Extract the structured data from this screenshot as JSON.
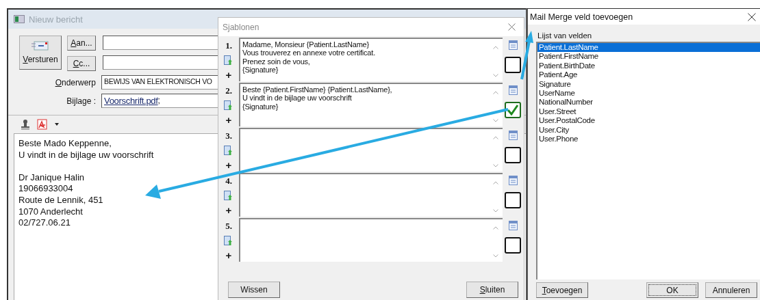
{
  "compose_window": {
    "title": "Nieuw bericht",
    "send_button": "Versturen",
    "to_button": "Aan...",
    "cc_button": "Cc...",
    "subject_label": "Onderwerp",
    "subject_value": "BEWIJS VAN ELEKTRONISCH VO",
    "attachment_label": "Bijlage :",
    "attachment_link": "Voorschrift.pdf",
    "attachment_suffix": ";",
    "body": "Beste Mado Keppenne,\nU vindt in de bijlage uw voorschrift\n\nDr Janique Halin\n19066933004\nRoute de Lennik, 451\n1070 Anderlecht\n02/727.06.21"
  },
  "templates_window": {
    "title": "Sjablonen",
    "templates": [
      {
        "number": "1.",
        "add": "+",
        "text": "Madame, Monsieur {Patient.LastName}\nVous trouverez en annexe votre certificat.\nPrenez soin de vous,\n{Signature}",
        "checked": false
      },
      {
        "number": "2.",
        "add": "+",
        "text": "Beste {Patient.FirstName} {Patient.LastName},\nU vindt in de bijlage uw voorschrift\n{Signature}",
        "checked": true
      },
      {
        "number": "3.",
        "add": "+",
        "checked": false
      },
      {
        "number": "4.",
        "add": "+",
        "checked": false
      },
      {
        "number": "5.",
        "add": "+",
        "checked": false
      }
    ],
    "clear_button": "Wissen",
    "close_button": "Sluiten"
  },
  "merge_window": {
    "title": "Mail Merge veld toevoegen",
    "list_label": "Lijst van velden",
    "fields": [
      {
        "label": "Patient.LastName",
        "selected": true
      },
      {
        "label": "Patient.FirstName",
        "selected": false
      },
      {
        "label": "Patient.BirthDate",
        "selected": false
      },
      {
        "label": "Patient.Age",
        "selected": false
      },
      {
        "label": "Signature",
        "selected": false
      },
      {
        "label": "UserName",
        "selected": false
      },
      {
        "label": "NationalNumber",
        "selected": false
      },
      {
        "label": "User.Street",
        "selected": false
      },
      {
        "label": "User.PostalCode",
        "selected": false
      },
      {
        "label": "User.City",
        "selected": false
      },
      {
        "label": "User.Phone",
        "selected": false
      }
    ],
    "add_button": "Toevoegen",
    "ok_button": "OK",
    "cancel_button": "Annuleren"
  }
}
